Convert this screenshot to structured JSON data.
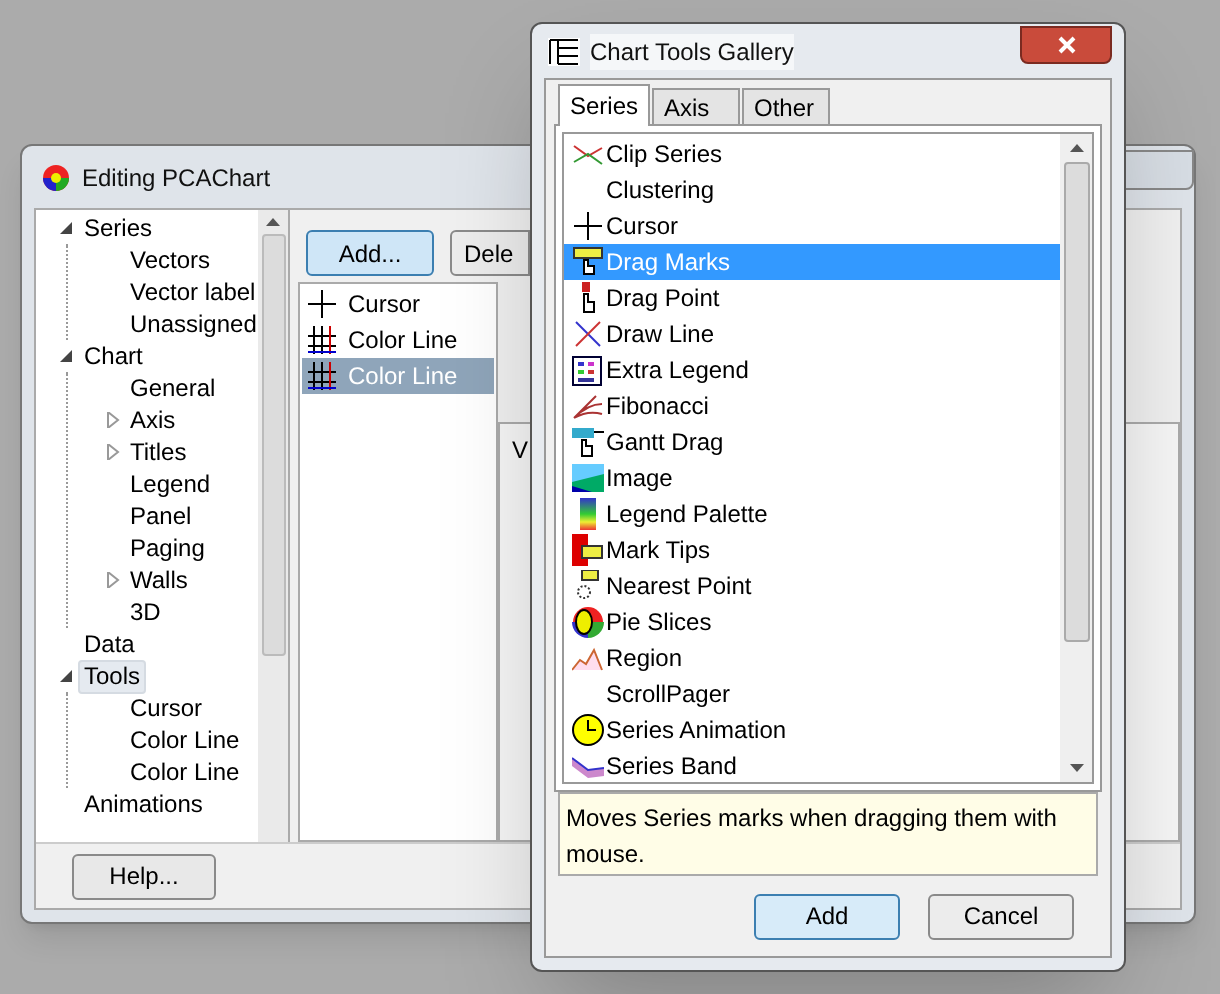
{
  "back_window": {
    "title": "Editing PCAChart",
    "tree": [
      {
        "label": "Series",
        "expanded": true,
        "selected": false,
        "children": [
          {
            "label": "Vectors",
            "selected": false
          },
          {
            "label": "Vector label",
            "selected": false
          },
          {
            "label": "Unassigned",
            "selected": false
          }
        ]
      },
      {
        "label": "Chart",
        "expanded": true,
        "selected": false,
        "children": [
          {
            "label": "General",
            "selected": false
          },
          {
            "label": "Axis",
            "expanded": false,
            "selected": false
          },
          {
            "label": "Titles",
            "expanded": false,
            "selected": false
          },
          {
            "label": "Legend",
            "selected": false
          },
          {
            "label": "Panel",
            "selected": false
          },
          {
            "label": "Paging",
            "selected": false
          },
          {
            "label": "Walls",
            "expanded": false,
            "selected": false
          },
          {
            "label": "3D",
            "selected": false
          }
        ]
      },
      {
        "label": "Data",
        "selected": false
      },
      {
        "label": "Tools",
        "expanded": true,
        "selected": true,
        "children": [
          {
            "label": "Cursor",
            "selected": false
          },
          {
            "label": "Color Line",
            "selected": false
          },
          {
            "label": "Color Line",
            "selected": false
          }
        ]
      },
      {
        "label": "Animations",
        "selected": false
      }
    ],
    "buttons": [
      "Add...",
      "Dele"
    ],
    "tools": [
      {
        "label": "Cursor",
        "kind": "cursor",
        "selected": false
      },
      {
        "label": "Color Line",
        "kind": "colorline",
        "selected": false
      },
      {
        "label": "Color Line",
        "kind": "colorline",
        "selected": true
      }
    ],
    "panel_tab": "V",
    "help_button": "Help..."
  },
  "gallery": {
    "title": "Chart Tools Gallery",
    "tabs": [
      {
        "label": "Series",
        "selected": true
      },
      {
        "label": "Axis",
        "selected": false
      },
      {
        "label": "Other",
        "selected": false
      }
    ],
    "items": [
      {
        "label": "Clip Series",
        "selected": false
      },
      {
        "label": "Clustering",
        "selected": false
      },
      {
        "label": "Cursor",
        "selected": false
      },
      {
        "label": "Drag Marks",
        "selected": true
      },
      {
        "label": "Drag Point",
        "selected": false
      },
      {
        "label": "Draw Line",
        "selected": false
      },
      {
        "label": "Extra Legend",
        "selected": false
      },
      {
        "label": "Fibonacci",
        "selected": false
      },
      {
        "label": "Gantt Drag",
        "selected": false
      },
      {
        "label": "Image",
        "selected": false
      },
      {
        "label": "Legend Palette",
        "selected": false
      },
      {
        "label": "Mark Tips",
        "selected": false
      },
      {
        "label": "Nearest Point",
        "selected": false
      },
      {
        "label": "Pie Slices",
        "selected": false
      },
      {
        "label": "Region",
        "selected": false
      },
      {
        "label": "ScrollPager",
        "selected": false
      },
      {
        "label": "Series Animation",
        "selected": false
      },
      {
        "label": "Series Band",
        "selected": false
      }
    ],
    "description": "Moves Series marks when dragging them with mouse.",
    "buttons": [
      "Add",
      "Cancel"
    ]
  }
}
